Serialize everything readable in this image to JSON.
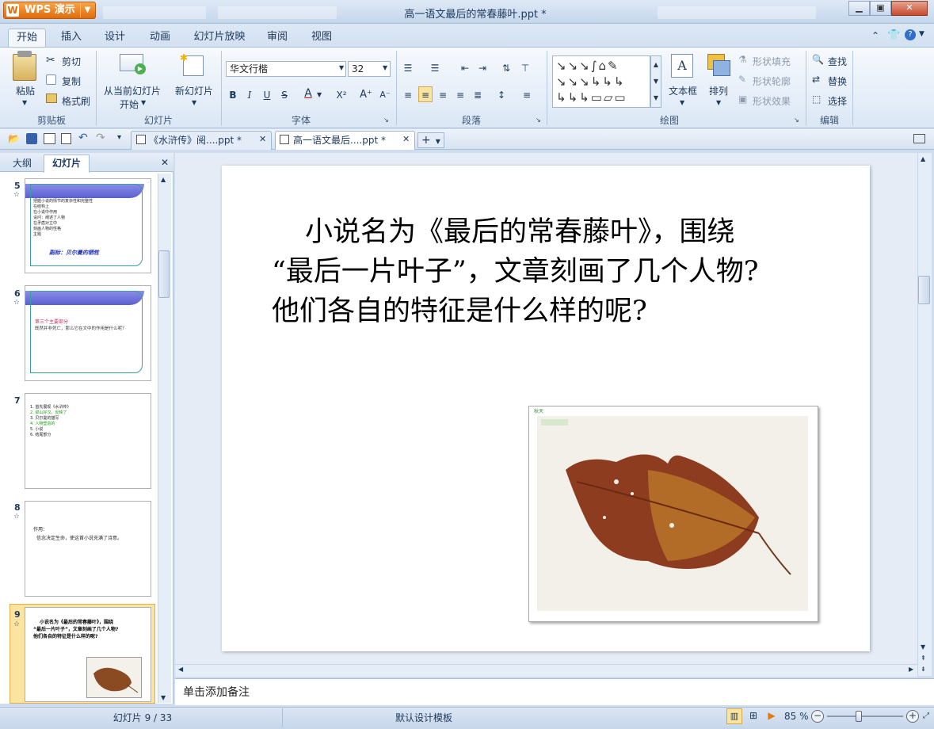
{
  "app": {
    "name": "WPS 演示",
    "window_title": "高一语文最后的常春藤叶.ppt *"
  },
  "menu_tabs": [
    "开始",
    "插入",
    "设计",
    "动画",
    "幻灯片放映",
    "审阅",
    "视图"
  ],
  "ribbon": {
    "clipboard": {
      "paste": "粘贴",
      "cut": "剪切",
      "copy": "复制",
      "format_painter": "格式刷",
      "group": "剪贴板"
    },
    "slides": {
      "from_current_line1": "从当前幻灯片",
      "from_current_line2": "开始",
      "new_slide": "新幻灯片",
      "group": "幻灯片"
    },
    "font": {
      "name": "华文行楷",
      "size": "32",
      "bold": "B",
      "italic": "I",
      "underline": "U",
      "strike": "S",
      "font_color": "A",
      "superscript": "X²",
      "grow": "A⁺",
      "shrink": "A⁻",
      "group": "字体"
    },
    "paragraph": {
      "group": "段落"
    },
    "drawing": {
      "textbox": "文本框",
      "arrange": "排列",
      "shape_fill": "形状填充",
      "shape_outline": "形状轮廓",
      "shape_effect": "形状效果",
      "group": "绘图"
    },
    "edit": {
      "find": "查找",
      "replace": "替换",
      "select": "选择",
      "group": "编辑"
    }
  },
  "doc_tabs": [
    "《水浒传》阅....ppt *",
    "高一语文最后....ppt *"
  ],
  "left_pane": {
    "tabs": [
      "大纲",
      "幻灯片"
    ],
    "thumbs": [
      {
        "num": "5",
        "lines": [
          "把握小说的情节的复杂性和完整性",
          "在结构上",
          "在小说中作用",
          "设问：阐述了人物",
          "在矛盾对立中",
          "刻画人物的性格",
          "主题"
        ],
        "footer": "副标：贝尔曼的牺牲"
      },
      {
        "num": "6",
        "lines": [
          "第三个主要部分",
          "既然并非死亡，那么它在文中的作用是什么呢？"
        ]
      },
      {
        "num": "7",
        "lines": [
          "1.  首先展现《水浒传》",
          "2.  梁山好汉，反映了",
          "3.  贝尔曼的描写",
          "4.  人物塑造的",
          "5.  小说",
          "6.  结尾部分"
        ]
      },
      {
        "num": "8",
        "lines": [
          "作用：",
          "信念决定生命，使这首小说充满了诗意。"
        ]
      },
      {
        "num": "9",
        "lines": [
          "小说名为《最后的常春藤叶》，围绕",
          "“最后一片叶子”，文章刻画了几个人物?",
          "他们各自的特征是什么样的呢?"
        ]
      }
    ]
  },
  "slide": {
    "lines": [
      "小说名为《最后的常春藤叶》，围绕",
      "“最后一片叶子”，文章刻画了几个人物?",
      "他们各自的特征是什么样的呢?"
    ],
    "image_caption": "秋天"
  },
  "notes_placeholder": "单击添加备注",
  "status": {
    "slide_counter": "幻灯片 9 / 33",
    "template": "默认设计模板",
    "zoom": "85 %"
  }
}
